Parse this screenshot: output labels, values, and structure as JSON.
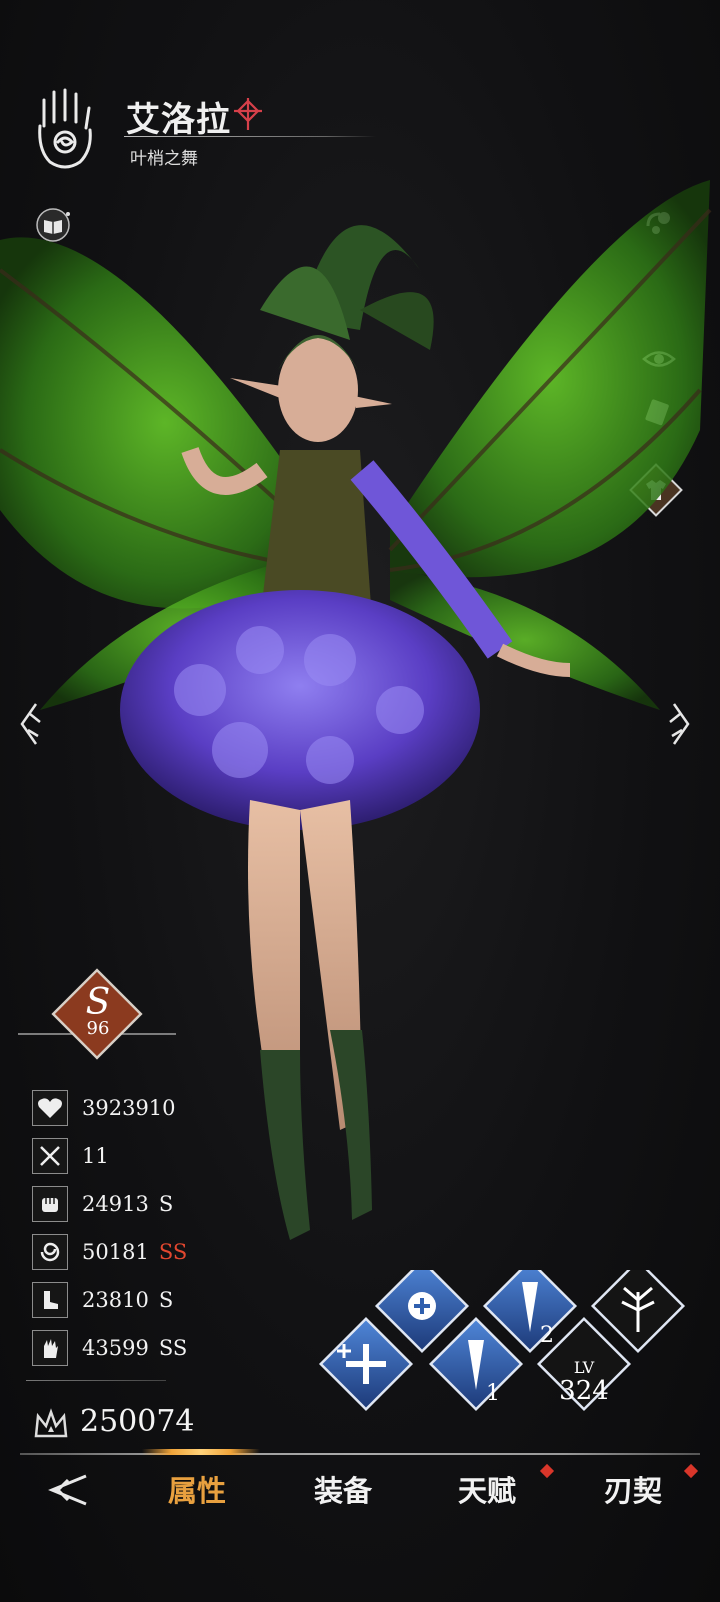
{
  "character": {
    "name": "艾洛拉",
    "subtitle": "叶梢之舞"
  },
  "grade": {
    "rank": "S",
    "level": "96"
  },
  "stats": [
    {
      "icon": "heart-icon",
      "value": "3923910",
      "grade": ""
    },
    {
      "icon": "crossed-swords-icon",
      "value": "11",
      "grade": ""
    },
    {
      "icon": "fist-icon",
      "value": "24913",
      "grade": "S"
    },
    {
      "icon": "swirl-icon",
      "value": "50181",
      "grade": "SS"
    },
    {
      "icon": "boot-icon",
      "value": "23810",
      "grade": "S"
    },
    {
      "icon": "hand-icon",
      "value": "43599",
      "grade": "SS"
    }
  ],
  "power": {
    "value": "250074"
  },
  "level_badge": {
    "label": "LV",
    "value": "324"
  },
  "skills": {
    "skill1_num": "1",
    "skill2_num": "2"
  },
  "nav": {
    "tabs": [
      {
        "label": "属性",
        "active": true
      },
      {
        "label": "装备",
        "active": false
      },
      {
        "label": "天赋",
        "active": false
      },
      {
        "label": "刃契",
        "active": false
      }
    ]
  },
  "colors": {
    "accent_gold": "#e8a03f",
    "ss_red": "#e2472f",
    "skill_blue": "#2f5fae",
    "notification_red": "#d9362a"
  }
}
